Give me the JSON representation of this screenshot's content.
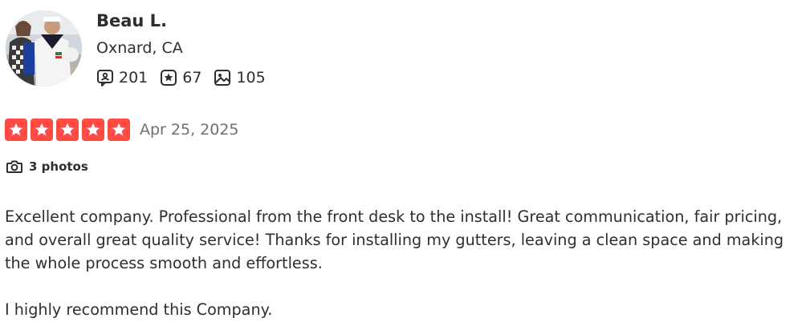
{
  "user": {
    "name": "Beau L.",
    "location": "Oxnard, CA",
    "stats": {
      "reviews": "201",
      "friends": "67",
      "photos": "105"
    },
    "icons": {
      "reviews": "review-bubble-icon",
      "friends": "star-badge-icon",
      "photos": "image-icon"
    }
  },
  "review": {
    "rating": 5,
    "rating_max": 5,
    "star_color": "#ff4b44",
    "date": "Apr 25, 2025",
    "photos_label": "3 photos",
    "paragraphs": [
      "Excellent company. Professional from the front desk to the install! Great communication, fair pricing, and overall great quality service! Thanks for installing my gutters, leaving a clean space and making the whole process smooth and effortless.",
      "I highly recommend this Company."
    ]
  }
}
